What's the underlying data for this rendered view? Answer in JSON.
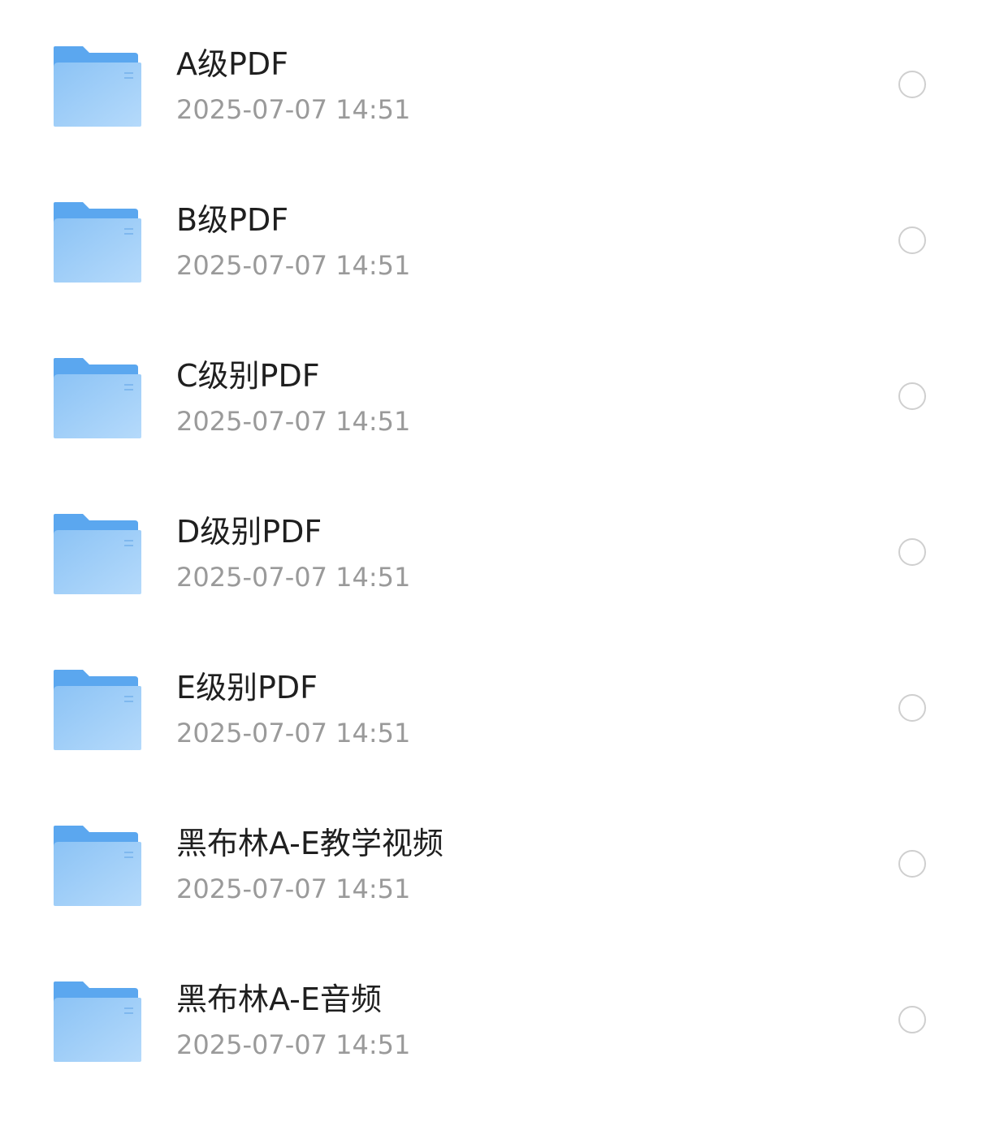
{
  "folder_icon": "folder-icon",
  "radio_icon": "radio-unchecked-icon",
  "colors": {
    "folder_back": "#5ba7ef",
    "folder_front_start": "#8cc3f5",
    "folder_front_end": "#b5dafb",
    "title_text": "#1f1f1f",
    "date_text": "#9a9a9a",
    "radio_border": "#cfcfcf"
  },
  "items": [
    {
      "name": "A级PDF",
      "date": "2025-07-07 14:51"
    },
    {
      "name": "B级PDF",
      "date": "2025-07-07 14:51"
    },
    {
      "name": "C级别PDF",
      "date": "2025-07-07 14:51"
    },
    {
      "name": "D级别PDF",
      "date": "2025-07-07 14:51"
    },
    {
      "name": "E级别PDF",
      "date": "2025-07-07 14:51"
    },
    {
      "name": "黑布林A-E教学视频",
      "date": "2025-07-07 14:51"
    },
    {
      "name": "黑布林A-E音频",
      "date": "2025-07-07 14:51"
    }
  ]
}
